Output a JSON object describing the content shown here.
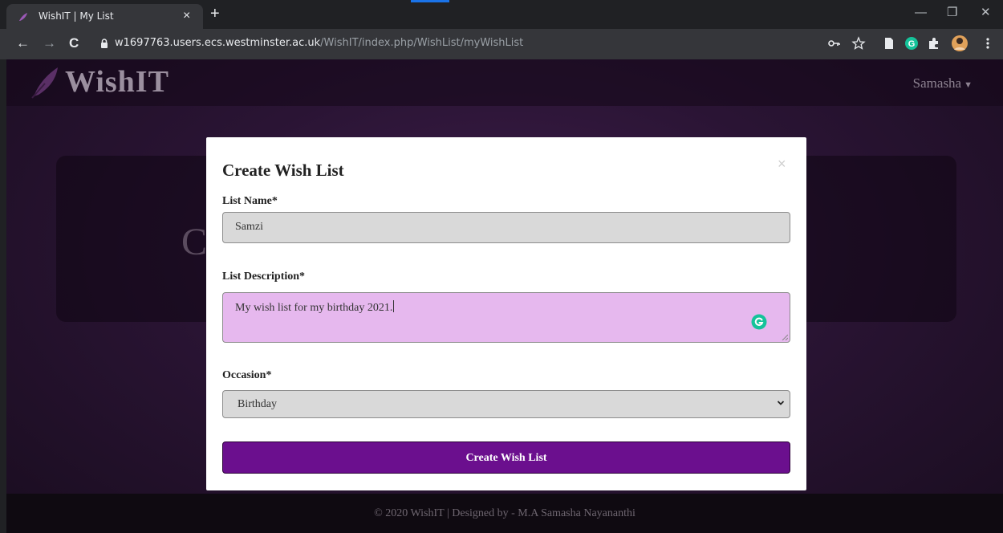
{
  "browser": {
    "tab_title": "WishIT | My List",
    "tab_close": "×",
    "new_tab": "+",
    "url_host": "w1697763.users.ecs.westminster.ac.uk",
    "url_path": "/WishIT/index.php/WishList/myWishList",
    "nav": {
      "back": "←",
      "forward": "→",
      "reload": "C"
    },
    "window": {
      "minimize": "—",
      "restore": "❐",
      "close": "✕"
    },
    "icons": [
      "key-icon",
      "star-icon",
      "reading-list-icon",
      "grammarly-extension-icon",
      "extensions-puzzle-icon",
      "profile-avatar-icon",
      "menu-icon"
    ]
  },
  "site": {
    "brand": "WishIT",
    "user": "Samasha",
    "hero_text": "C",
    "footer": "© 2020 WishIT | Designed by - M.A Samasha Nayananthi"
  },
  "modal": {
    "title": "Create Wish List",
    "close": "×",
    "list_name_label": "List Name*",
    "list_name_value": "Samzi",
    "description_label": "List Description*",
    "description_value": "My wish list for my birthday 2021.",
    "occasion_label": "Occasion*",
    "occasion_value": "Birthday",
    "submit_label": "Create Wish List"
  },
  "colors": {
    "accent": "#6b0f8e",
    "textarea_bg": "#e6b8ee",
    "page_bg": "#2a1434"
  }
}
